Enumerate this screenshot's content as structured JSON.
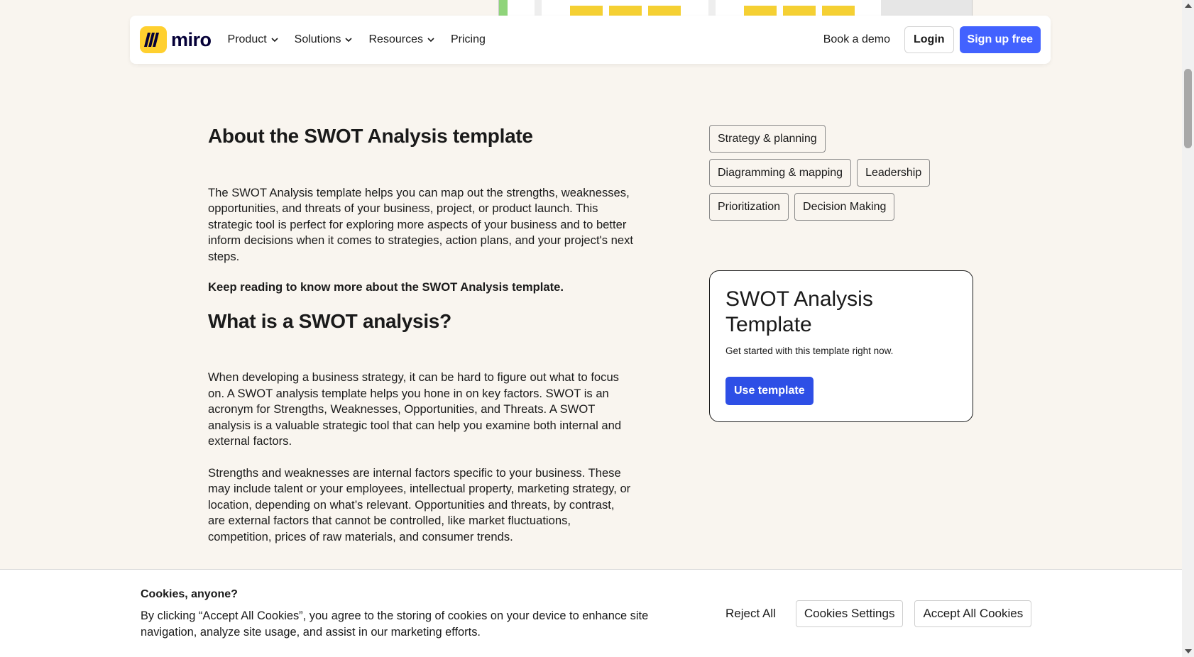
{
  "colors": {
    "page_bg": "#f9f5ef",
    "brand_yellow": "#ffd02f",
    "primary_blue": "#4262ff",
    "button_blue": "#2e4fe6"
  },
  "nav": {
    "logo_text": "miro",
    "logo_icon": "miro-logo-icon",
    "links": [
      {
        "label": "Product",
        "has_dropdown": true
      },
      {
        "label": "Solutions",
        "has_dropdown": true
      },
      {
        "label": "Resources",
        "has_dropdown": true
      },
      {
        "label": "Pricing",
        "has_dropdown": false
      }
    ],
    "book_demo": "Book a demo",
    "login": "Login",
    "signup": "Sign up free"
  },
  "about": {
    "heading": "About the SWOT Analysis template",
    "paragraph": "The SWOT Analysis template helps you can map out the strengths, weaknesses, opportunities, and threats of your business, project, or product launch. This strategic tool is perfect for exploring more aspects of your business and to better inform decisions when it comes to strategies, action plans, and your project's next steps.",
    "keep_reading": "Keep reading to know more about the SWOT Analysis template."
  },
  "what_is": {
    "heading": "What is a SWOT analysis?",
    "paragraph1": "When developing a business strategy, it can be hard to figure out what to focus on. A SWOT analysis template helps you hone in on key factors. SWOT is an acronym for Strengths, Weaknesses, Opportunities, and Threats. A SWOT analysis is a valuable strategic tool that can help you examine both internal and external factors.",
    "paragraph2": "Strengths and weaknesses are internal factors specific to your business. These may include talent or your employees, intellectual property, marketing strategy, or location, depending on what’s relevant. Opportunities and threats, by contrast, are external factors that cannot be controlled, like market fluctuations, competition, prices of raw materials, and consumer trends."
  },
  "tags": [
    [
      "Strategy & planning"
    ],
    [
      "Diagramming & mapping",
      "Leadership"
    ],
    [
      "Prioritization",
      "Decision Making"
    ]
  ],
  "template_card": {
    "title": "SWOT Analysis Template",
    "subtitle": "Get started with this template right now.",
    "button": "Use template"
  },
  "cookie": {
    "title": "Cookies, anyone?",
    "text": "By clicking “Accept All Cookies”, you agree to the storing of cookies on your device to enhance site navigation, analyze site usage, and assist in our marketing efforts.",
    "reject": "Reject All",
    "settings": "Cookies Settings",
    "accept": "Accept All Cookies"
  }
}
